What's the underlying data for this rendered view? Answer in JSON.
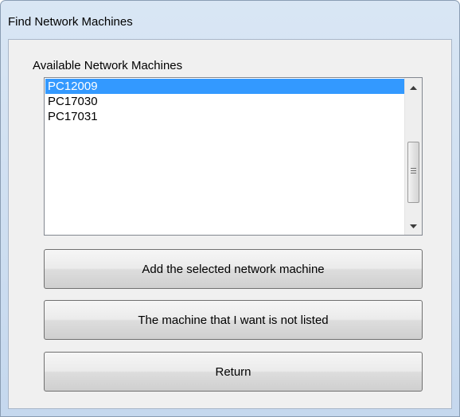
{
  "window": {
    "title": "Find Network Machines"
  },
  "list": {
    "label": "Available Network Machines",
    "items": [
      "PC12009",
      "PC17030",
      "PC17031"
    ],
    "selected_index": 0
  },
  "buttons": {
    "add": "Add the selected network machine",
    "not_listed": "The machine that I want is not listed",
    "return": "Return"
  },
  "icons": {
    "scroll_up": "scroll-up-arrow",
    "scroll_down": "scroll-down-arrow"
  },
  "colors": {
    "selection": "#3399ff",
    "window_frame": "#c5d8ee"
  }
}
